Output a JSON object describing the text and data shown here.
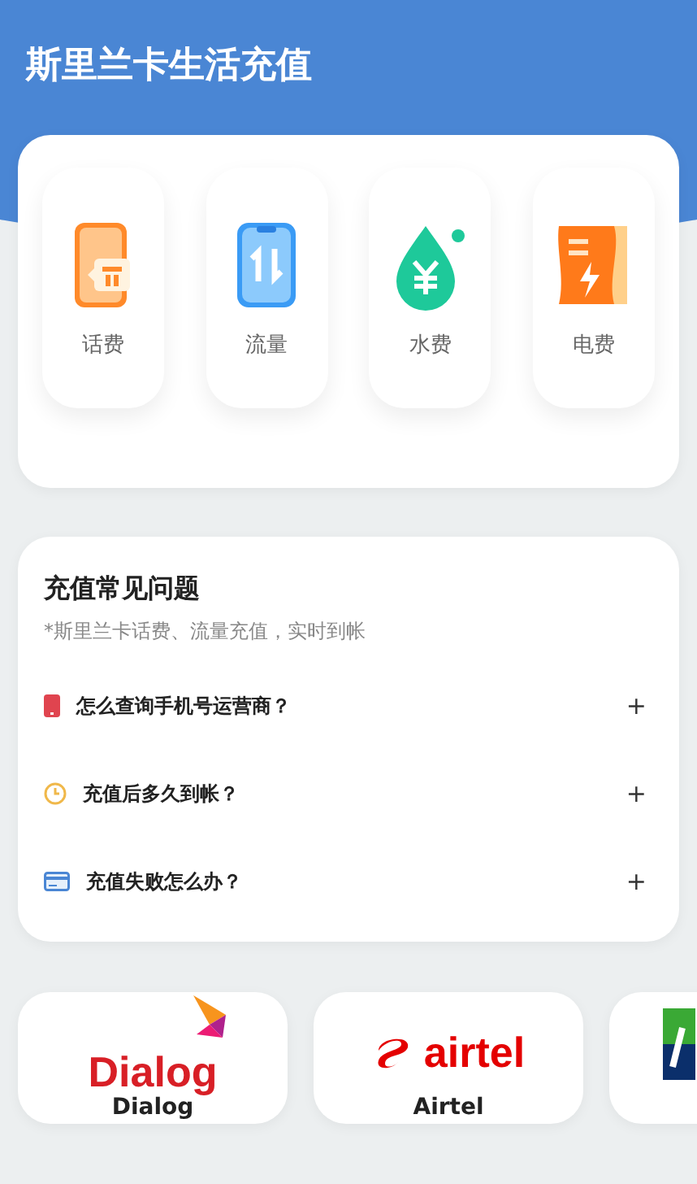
{
  "header": {
    "title": "斯里兰卡生活充值"
  },
  "services": [
    {
      "kind": "phone",
      "label": "话费"
    },
    {
      "kind": "data",
      "label": "流量"
    },
    {
      "kind": "water",
      "label": "水费"
    },
    {
      "kind": "power",
      "label": "电费"
    }
  ],
  "faq": {
    "title": "充值常见问题",
    "subtitle": "*斯里兰卡话费、流量充值，实时到帐",
    "items": [
      {
        "kind": "phone",
        "question": "怎么查询手机号运营商？",
        "toggle": "+"
      },
      {
        "kind": "clock",
        "question": "充值后多久到帐？",
        "toggle": "+"
      },
      {
        "kind": "card",
        "question": "充值失败怎么办？",
        "toggle": "+"
      }
    ]
  },
  "operators": [
    {
      "kind": "dialog",
      "logo_text": "Dialog",
      "name": "Dialog"
    },
    {
      "kind": "airtel",
      "logo_text": "airtel",
      "name": "Airtel"
    },
    {
      "kind": "mobitel"
    }
  ]
}
